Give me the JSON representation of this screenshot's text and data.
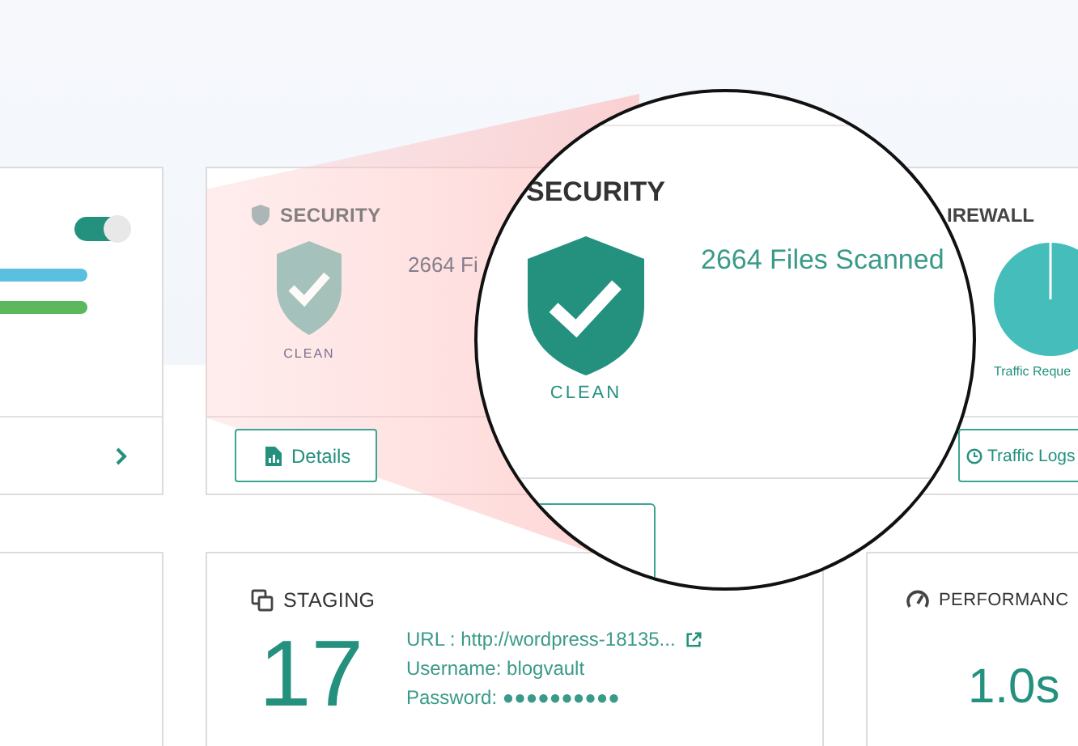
{
  "left_card": {
    "toggle": {
      "on": true
    },
    "bars": [
      {
        "color": "#5bc0e0"
      },
      {
        "color": "#5cb85c"
      }
    ]
  },
  "security_card": {
    "title": "SECURITY",
    "status": "CLEAN",
    "files": "2664 Fi",
    "button": "Details"
  },
  "magnifier": {
    "title": "SECURITY",
    "status": "CLEAN",
    "files": "2664 Files Scanned"
  },
  "firewall_card": {
    "title": "IREWALL",
    "chart_label": "Traffic Reque",
    "button": "Traffic Logs"
  },
  "staging_card": {
    "title": "STAGING",
    "count": "17",
    "url": "URL : http://wordpress-18135...",
    "username": "Username: blogvault",
    "password": "Password: ●●●●●●●●●●"
  },
  "performance_card": {
    "title": "PERFORMANC",
    "value": "1.0s"
  }
}
